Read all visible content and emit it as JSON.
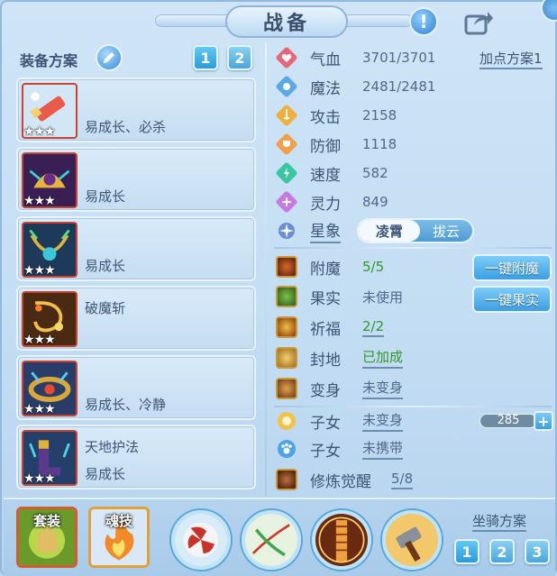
{
  "window": {
    "title": "战备"
  },
  "equipment_plan": {
    "label": "装备方案",
    "tabs": [
      "1",
      "2"
    ],
    "active_tab": "1"
  },
  "equipment": [
    {
      "line1": "",
      "line2": "易成长、必杀",
      "stars": "★★★"
    },
    {
      "line1": "",
      "line2": "易成长",
      "stars": "★★★"
    },
    {
      "line1": "",
      "line2": "易成长",
      "stars": "★★★"
    },
    {
      "line1": "破魔斩",
      "line2": "",
      "stars": "★★★"
    },
    {
      "line1": "",
      "line2": "易成长、冷静",
      "stars": "★★★"
    },
    {
      "line1": "天地护法",
      "line2": "易成长",
      "stars": "★★★"
    }
  ],
  "stats": {
    "add_point_plan": "加点方案1",
    "rows": [
      {
        "label": "气血",
        "value": "3701/3701",
        "icon": "heart-icon"
      },
      {
        "label": "魔法",
        "value": "2481/2481",
        "icon": "mana-icon"
      },
      {
        "label": "攻击",
        "value": "2158",
        "icon": "sword-icon"
      },
      {
        "label": "防御",
        "value": "1118",
        "icon": "shield-icon"
      },
      {
        "label": "速度",
        "value": "582",
        "icon": "lightning-icon"
      },
      {
        "label": "灵力",
        "value": "849",
        "icon": "spirit-icon"
      }
    ],
    "constellation": {
      "label": "星象",
      "options": [
        "凌霄",
        "拔云"
      ],
      "selected": "凌霄"
    }
  },
  "extras": {
    "enchant": {
      "label": "附魔",
      "value": "5/5"
    },
    "fruit": {
      "label": "果实",
      "value": "未使用"
    },
    "blessing": {
      "label": "祈福",
      "value": "2/2"
    },
    "seal": {
      "label": "封地",
      "value": "已加成"
    },
    "transform": {
      "label": "变身",
      "value": "未变身"
    },
    "child1": {
      "label": "子女",
      "value": "未变身"
    },
    "child2": {
      "label": "子女",
      "value": "未携带"
    },
    "cultivation": {
      "label": "修炼觉醒",
      "value": "5/8"
    },
    "one_key_enchant": "一键附魔",
    "one_key_fruit": "一键果实",
    "counter_value": "285"
  },
  "bottom": {
    "set_label": "套装",
    "soul_label": "魂技",
    "mount_plan_label": "坐骑方案",
    "mount_tabs": [
      "1",
      "2",
      "3"
    ],
    "mount_active": "1"
  },
  "colors": {
    "panel_bg": "#c3ddf3",
    "text": "#3d5575",
    "accent": "#3d9ee0",
    "success": "#2e9a2a",
    "equip_border": "#c7442e"
  }
}
